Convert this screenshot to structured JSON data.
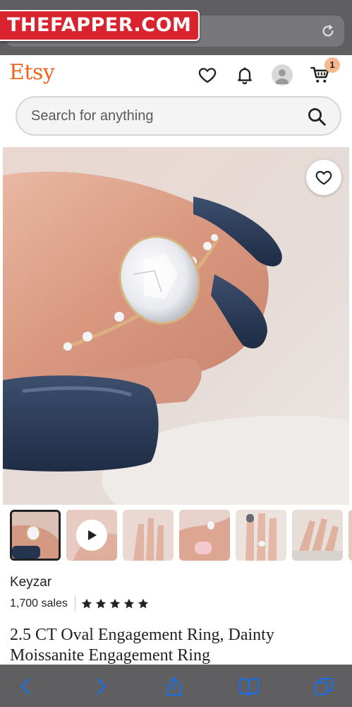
{
  "watermark": {
    "text": "THEFAPPER.COM"
  },
  "header": {
    "logo": "Etsy",
    "cart_count": "1",
    "icons": [
      "heart-icon",
      "bell-icon",
      "user-icon",
      "cart-icon"
    ]
  },
  "search": {
    "placeholder": "Search for anything",
    "value": ""
  },
  "product": {
    "shop_name": "Keyzar",
    "sales": "1,700 sales",
    "rating": 5,
    "title": "2.5 CT Oval Engagement Ring, Dainty Moissanite Engagement Ring",
    "thumbnail_count": 7,
    "selected_thumbnail": 1
  },
  "colors": {
    "brand": "#f1641e",
    "browser_chrome": "#5f5f62",
    "toolbar_icons": "#1a6fe8",
    "cart_badge": "#f5b98f"
  }
}
